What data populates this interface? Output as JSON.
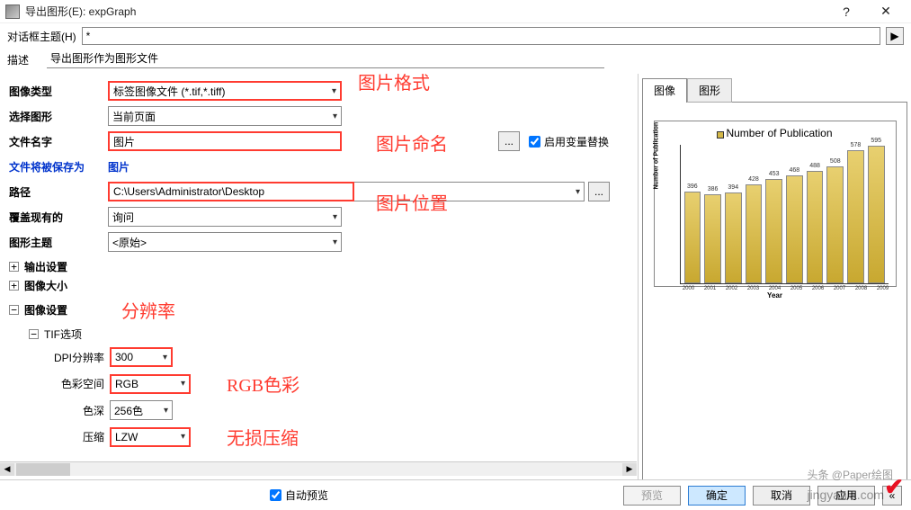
{
  "window": {
    "title": "导出图形(E): expGraph",
    "help": "?",
    "close": "✕"
  },
  "top": {
    "theme_label": "对话框主题(H)",
    "theme_value": "*",
    "desc_label": "描述",
    "desc_value": "导出图形作为图形文件"
  },
  "labels": {
    "image_type": "图像类型",
    "select_graph": "选择图形",
    "file_name": "文件名字",
    "save_as": "文件将被保存为",
    "save_as_val": "图片",
    "path": "路径",
    "overwrite": "覆盖现有的",
    "graph_theme": "图形主题"
  },
  "fields": {
    "image_type": "标签图像文件 (*.tif,*.tiff)",
    "select_graph": "当前页面",
    "file_name": "图片",
    "path": "C:\\Users\\Administrator\\Desktop",
    "overwrite": "询问",
    "graph_theme": "<原始>",
    "enable_var": "启用变量替换",
    "browse": "..."
  },
  "tree": {
    "output": "输出设置",
    "size": "图像大小",
    "settings": "图像设置",
    "tif": "TIF选项",
    "dpi_lbl": "DPI分辨率",
    "dpi": "300",
    "space_lbl": "色彩空间",
    "space": "RGB",
    "depth_lbl": "色深",
    "depth": "256色",
    "comp_lbl": "压缩",
    "comp": "LZW"
  },
  "annotations": {
    "format": "图片格式",
    "naming": "图片命名",
    "location": "图片位置",
    "resolution": "分辨率",
    "rgb": "RGB色彩",
    "lossless": "无损压缩"
  },
  "tabs": {
    "image": "图像",
    "graph": "图形"
  },
  "bottom": {
    "auto": "自动预览",
    "preview": "预览",
    "ok": "确定",
    "cancel": "取消",
    "apply": "应用",
    "collapse": "«"
  },
  "watermark": {
    "line1": "头条 @Paper绘图",
    "line2": "jingyanla.com"
  },
  "chart_data": {
    "type": "bar",
    "title": "Number of Publication",
    "xlabel": "Year",
    "ylabel": "Number of Publication",
    "ylim": [
      0,
      600
    ],
    "categories": [
      "2000",
      "2001",
      "2002",
      "2003",
      "2004",
      "2005",
      "2006",
      "2007",
      "2008",
      "2009"
    ],
    "values": [
      396,
      386,
      394,
      428,
      453,
      468,
      488,
      508,
      578,
      595
    ]
  }
}
